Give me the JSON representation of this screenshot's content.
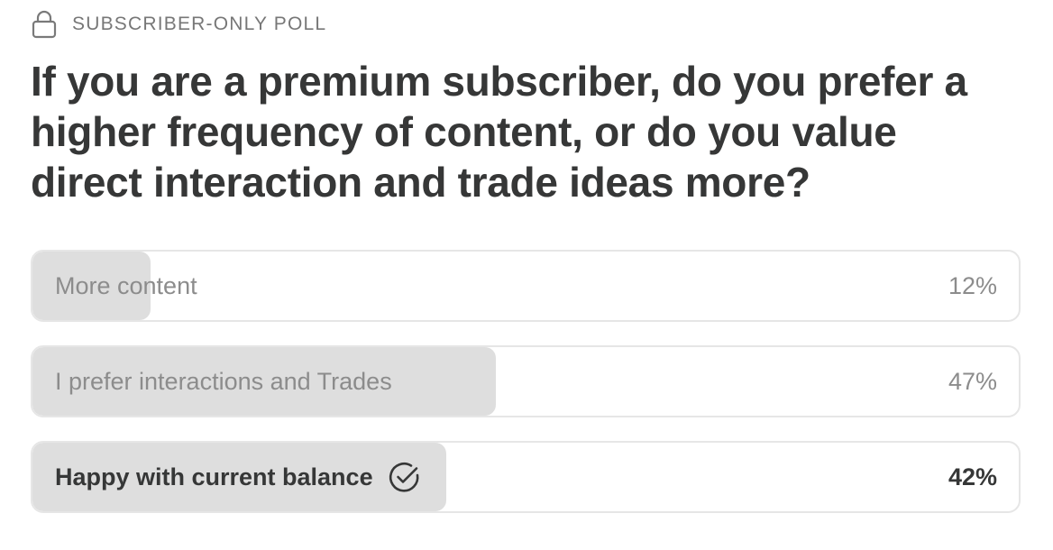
{
  "poll": {
    "header_icon": "lock-icon",
    "header_label": "SUBSCRIBER-ONLY POLL",
    "question": "If you are a premium subscriber, do you prefer a higher frequency of content, or do you value direct interaction and trade ideas more?",
    "options": [
      {
        "label": "More content",
        "percent_text": "12%",
        "percent": 12,
        "selected": false
      },
      {
        "label": "I prefer interactions and Trades",
        "percent_text": "47%",
        "percent": 47,
        "selected": false
      },
      {
        "label": "Happy with current balance",
        "percent_text": "42%",
        "percent": 42,
        "selected": true,
        "icon": "check-circle-icon"
      }
    ],
    "colors": {
      "fill": "#dedede",
      "border": "#e6e6e6",
      "text_dark": "#363737",
      "text_muted": "#8c8c8c"
    }
  }
}
